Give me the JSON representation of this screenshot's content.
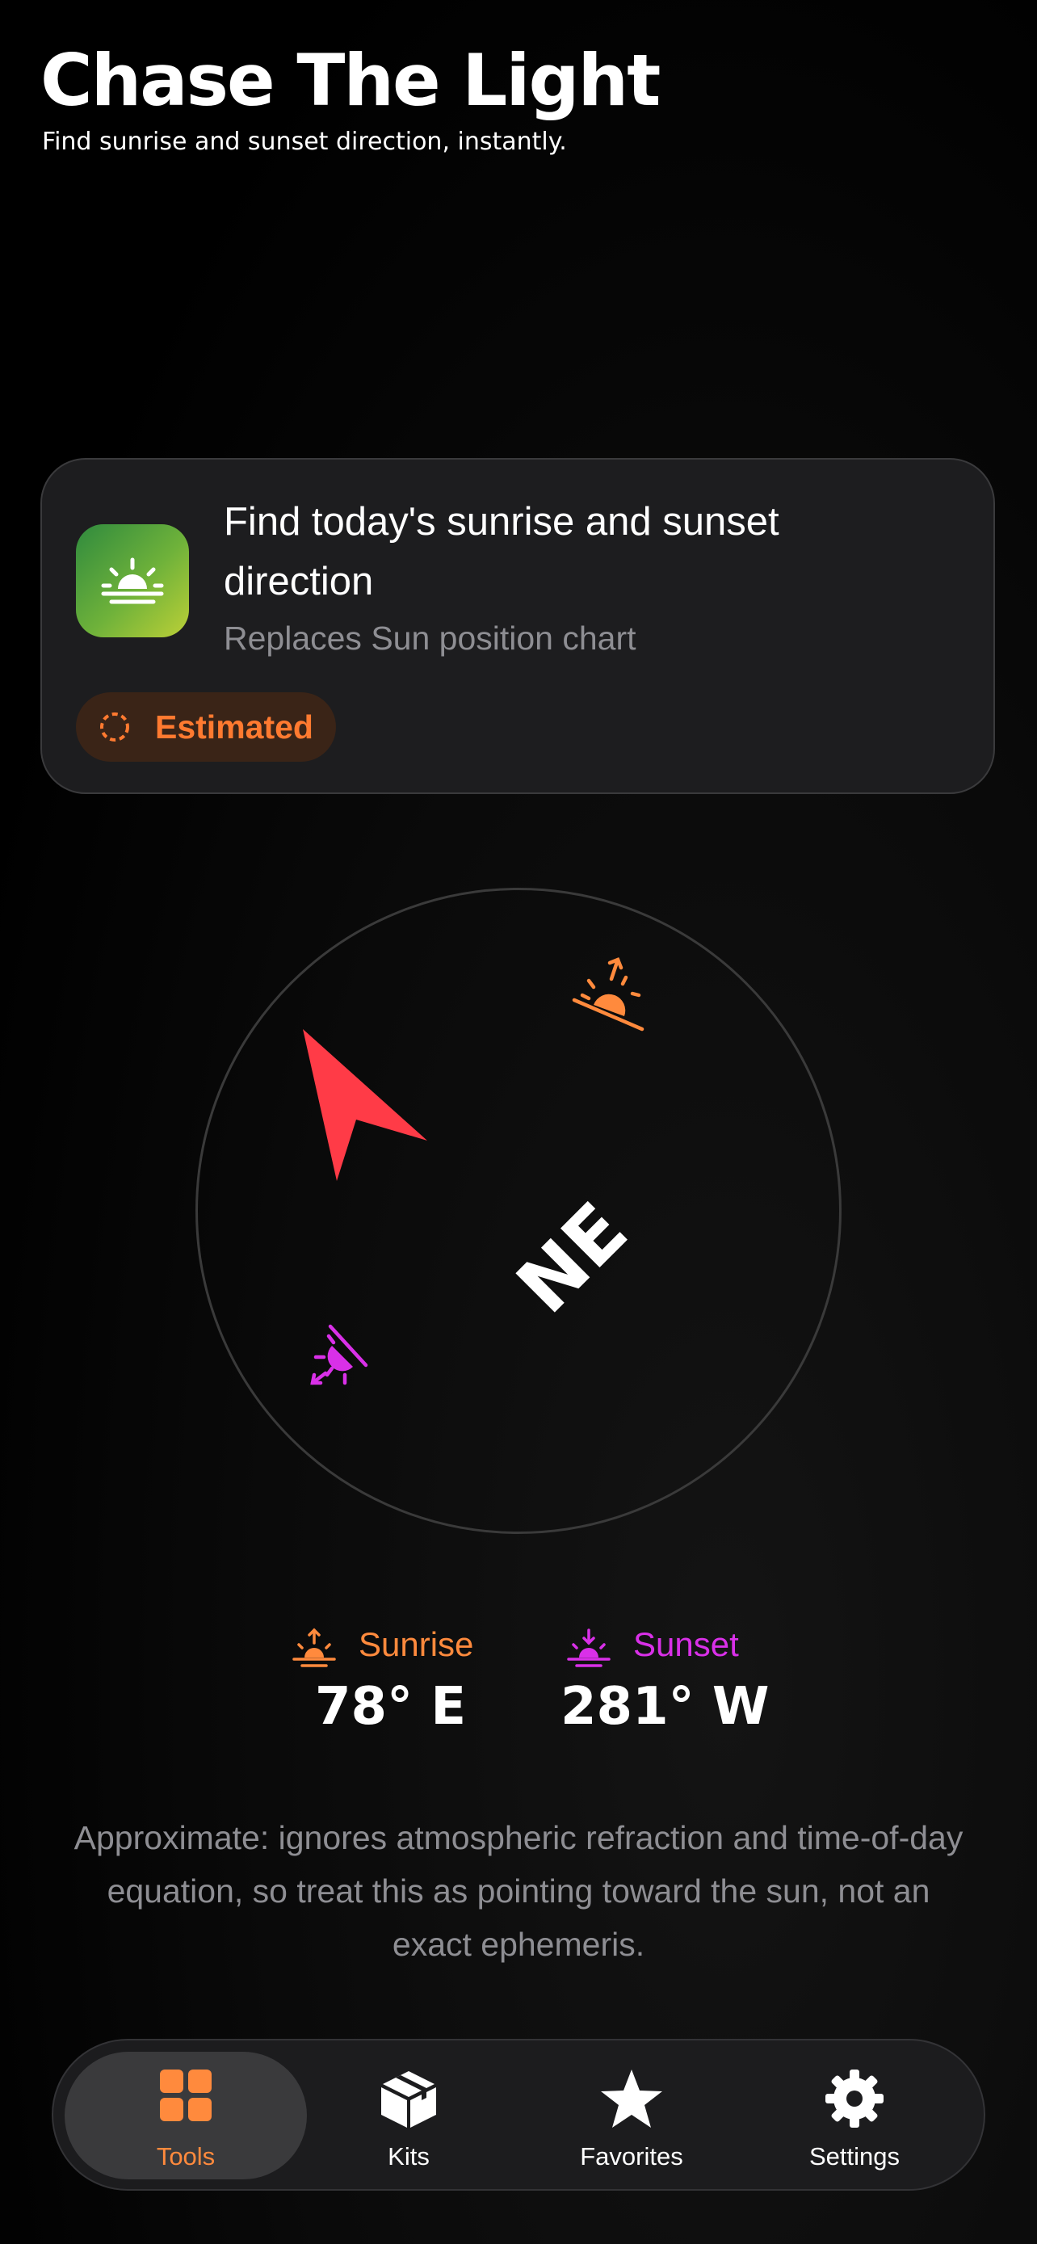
{
  "header": {
    "title": "Chase The Light",
    "subtitle": "Find sunrise and sunset direction, instantly."
  },
  "card": {
    "icon": "sunrise-icon",
    "title": "Find today's sunrise and sunset direction",
    "subtitle": "Replaces Sun position chart",
    "badge": "Estimated",
    "badge_icon": "dashed-circle-icon",
    "badge_color": "#ff7a30"
  },
  "compass": {
    "heading_label": "NE",
    "sunrise_azimuth": 78,
    "sunset_azimuth": 281,
    "arrow_color": "#ff3b47",
    "sunrise_icon": "sunrise-icon",
    "sunset_icon": "sunset-icon"
  },
  "readouts": {
    "sunrise_label": "Sunrise",
    "sunrise_value": "78° E",
    "sunrise_color": "#ff8a3d",
    "sunset_label": "Sunset",
    "sunset_value": "281° W",
    "sunset_color": "#d930e8"
  },
  "disclaimer": "Approximate: ignores atmospheric refraction and time-of-day equation, so treat this as pointing toward the sun, not an exact ephemeris.",
  "tabbar": {
    "accent_color": "#ff8a3d",
    "tabs": [
      {
        "label": "Tools",
        "icon": "grid-icon",
        "active": true
      },
      {
        "label": "Kits",
        "icon": "box-icon",
        "active": false
      },
      {
        "label": "Favorites",
        "icon": "star-icon",
        "active": false
      },
      {
        "label": "Settings",
        "icon": "gear-icon",
        "active": false
      }
    ]
  }
}
